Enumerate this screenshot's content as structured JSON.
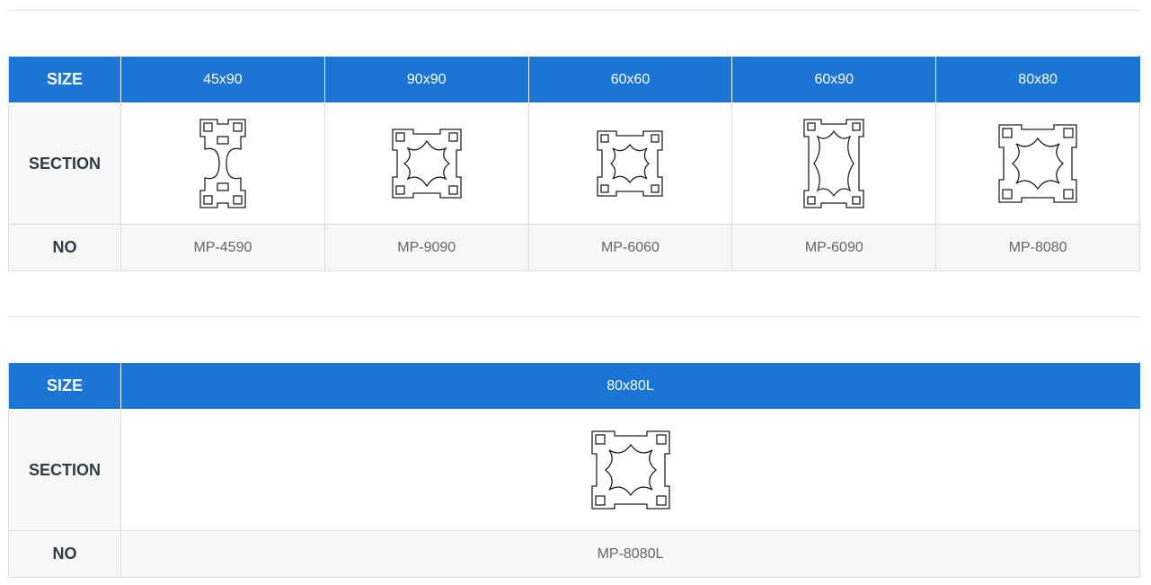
{
  "labels": {
    "size": "SIZE",
    "section": "SECTION",
    "no": "NO"
  },
  "table1": {
    "sizes": [
      "45x90",
      "90x90",
      "60x60",
      "60x90",
      "80x80"
    ],
    "numbers": [
      "MP-4590",
      "MP-9090",
      "MP-6060",
      "MP-6090",
      "MP-8080"
    ]
  },
  "table2": {
    "sizes": [
      "80x80L"
    ],
    "numbers": [
      "MP-8080L"
    ]
  },
  "colors": {
    "header_bg": "#1a75d6",
    "header_text": "#ffffff",
    "row_bg": "#f7f7f7"
  },
  "icons": [
    "profile-section-icon"
  ]
}
